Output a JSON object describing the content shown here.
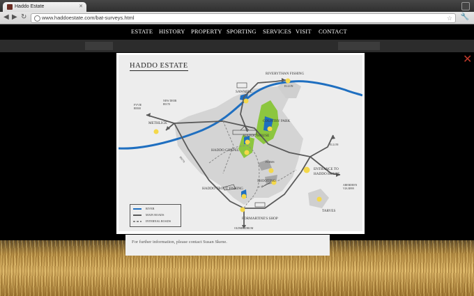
{
  "browser": {
    "tab_title": "Haddo Estate",
    "url": "www.haddoestate.com/bat-surveys.html"
  },
  "nav": {
    "items": [
      "ESTATE",
      "HISTORY",
      "PROPERTY",
      "SPORTING",
      "SERVICES",
      "VISIT",
      "CONTACT"
    ]
  },
  "content": {
    "note": "For further information, please contact Susan Skene."
  },
  "map": {
    "title": "HADDO ESTATE",
    "labels": {
      "riverythan_fishing": "RIVERYTHAN FISHING",
      "ellon_top": "ELLON",
      "sawmill": "SAWMILL",
      "country_park": "COUNTRY PARK",
      "haddo_house": "HADDO HOUSE",
      "methlick": "METHLICK",
      "haddo_chapel": "HADDO CHAPEL",
      "fyvie": "FYVIE\nB9500",
      "new_deer": "NEW DEER\nB9170",
      "ellon_right": "ELLON",
      "entrance": "ENTRANCE TO\nHADDO HOUSE",
      "farms": "FARMS",
      "shooting": "SHOOTING",
      "aberdeen": "ABERDEEN\nVIA B999",
      "haddo_trout": "HADDO TROUT FISHING",
      "tarves": "TARVES",
      "formartines": "FORMARTINE'S SHOP",
      "oldmeldrum": "OLDMELDRUM",
      "b9170": "B9170"
    },
    "legend": {
      "river": "RIVER",
      "main_roads": "MAIN ROADS",
      "internal_roads": "INTERNAL ROADS"
    },
    "colors": {
      "river": "#1f6fc0",
      "roads": "#5a5a5a",
      "park_green": "#8cc63f",
      "marker_yellow": "#f4d84a"
    }
  }
}
